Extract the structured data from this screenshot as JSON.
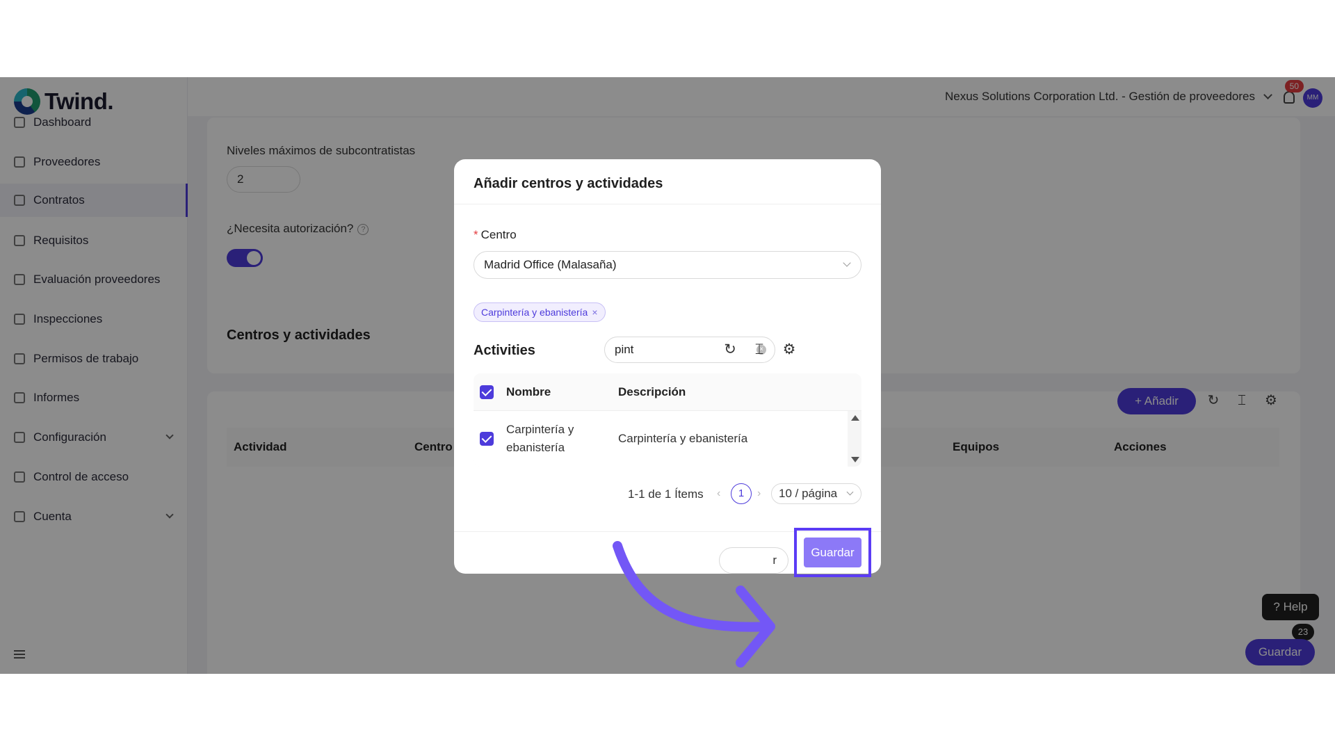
{
  "app": {
    "name": "Twind."
  },
  "sidebar": {
    "items": [
      {
        "label": "Dashboard"
      },
      {
        "label": "Proveedores"
      },
      {
        "label": "Contratos"
      },
      {
        "label": "Requisitos"
      },
      {
        "label": "Evaluación proveedores"
      },
      {
        "label": "Inspecciones"
      },
      {
        "label": "Permisos de trabajo"
      },
      {
        "label": "Informes"
      },
      {
        "label": "Configuración"
      },
      {
        "label": "Control de acceso"
      },
      {
        "label": "Cuenta"
      }
    ]
  },
  "header": {
    "org": "Nexus Solutions Corporation Ltd. - Gestión de proveedores",
    "notifications": "50",
    "avatar": "MM"
  },
  "background": {
    "levels_label": "Niveles máximos de subcontratistas",
    "levels_value": "2",
    "auth_label": "¿Necesita autorización?",
    "section_title": "Centros y actividades",
    "add_label": "Añadir",
    "columns": [
      "Actividad",
      "Centro",
      "Equipos",
      "Acciones"
    ],
    "help_label": "Help",
    "help_badge": "23",
    "save_label": "Guardar"
  },
  "modal": {
    "title": "Añadir centros y actividades",
    "centro_label": "Centro",
    "centro_value": "Madrid Office (Malasaña)",
    "tag": "Carpintería y ebanistería",
    "activities_title": "Activities",
    "search_value": "pint",
    "columns": {
      "name": "Nombre",
      "desc": "Descripción"
    },
    "row": {
      "name": "Carpintería y ebanistería",
      "desc": "Carpintería y ebanistería"
    },
    "pager": {
      "text": "1-1 de 1 Ítems",
      "page": "1",
      "size": "10 / página"
    },
    "cancel_label": "r",
    "save_label": "Guardar"
  },
  "colors": {
    "accent": "#4d3bdb",
    "highlight": "#5b3cf5"
  }
}
